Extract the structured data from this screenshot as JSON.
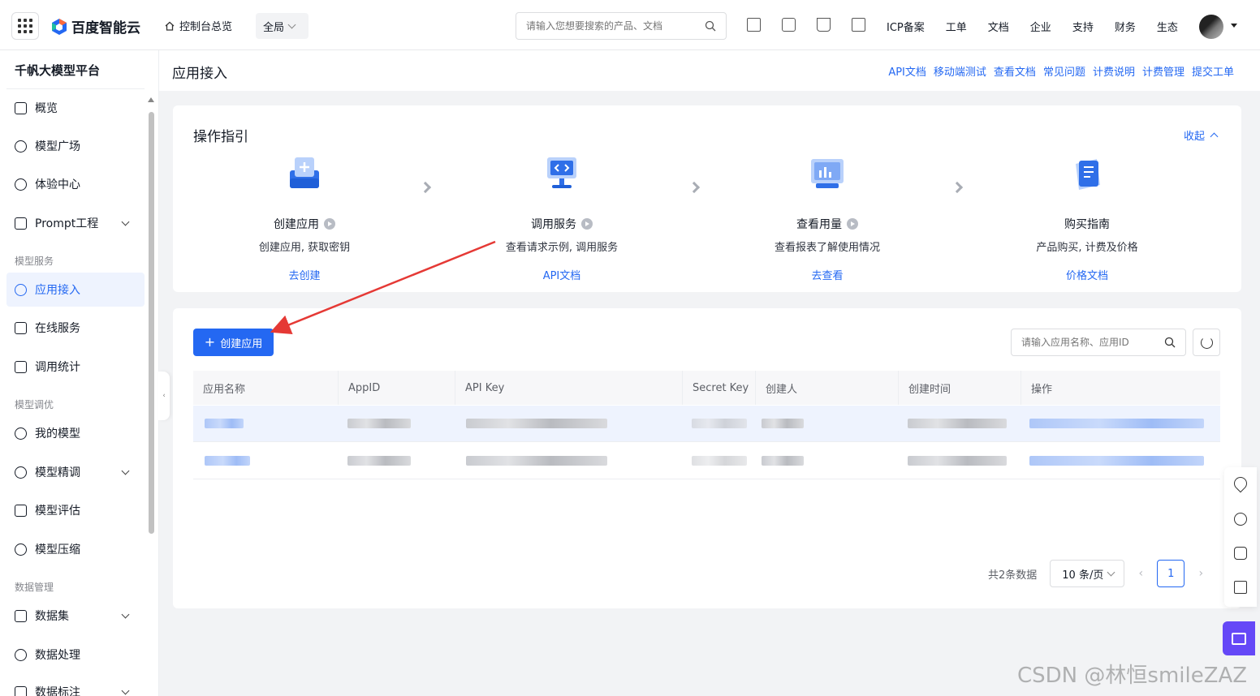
{
  "topbar": {
    "brand": "百度智能云",
    "home_link": "控制台总览",
    "region": "全局",
    "search_placeholder": "请输入您想要搜索的产品、文档",
    "nav": [
      "ICP备案",
      "工单",
      "文档",
      "企业",
      "支持",
      "财务",
      "生态"
    ],
    "icons": [
      "qrcode-icon",
      "message-icon",
      "cart-icon",
      "billing-icon"
    ]
  },
  "sidebar": {
    "title": "千帆大模型平台",
    "items": [
      {
        "label": "概览",
        "icon": "overview-icon"
      },
      {
        "label": "模型广场",
        "icon": "model-plaza-icon"
      },
      {
        "label": "体验中心",
        "icon": "experience-icon"
      },
      {
        "label": "Prompt工程",
        "icon": "prompt-icon",
        "expandable": true
      }
    ],
    "group_model_service": "模型服务",
    "service_items": [
      {
        "label": "应用接入",
        "icon": "app-access-icon",
        "active": true
      },
      {
        "label": "在线服务",
        "icon": "online-service-icon"
      },
      {
        "label": "调用统计",
        "icon": "call-stats-icon"
      }
    ],
    "group_model_tuning": "模型调优",
    "tuning_items": [
      {
        "label": "我的模型",
        "icon": "my-model-icon"
      },
      {
        "label": "模型精调",
        "icon": "fine-tune-icon",
        "expandable": true
      },
      {
        "label": "模型评估",
        "icon": "evaluate-icon"
      },
      {
        "label": "模型压缩",
        "icon": "compress-icon"
      }
    ],
    "group_data": "数据管理",
    "data_items": [
      {
        "label": "数据集",
        "icon": "dataset-icon",
        "expandable": true
      },
      {
        "label": "数据处理",
        "icon": "data-process-icon"
      },
      {
        "label": "数据标注",
        "icon": "data-label-icon",
        "expandable": true
      }
    ]
  },
  "page": {
    "title": "应用接入",
    "links": [
      "API文档",
      "移动端测试",
      "查看文档",
      "常见问题",
      "计费说明",
      "计费管理",
      "提交工单"
    ]
  },
  "guide": {
    "title": "操作指引",
    "collapse": "收起",
    "steps": [
      {
        "name": "创建应用",
        "desc": "创建应用, 获取密钥",
        "link": "去创建",
        "video": true
      },
      {
        "name": "调用服务",
        "desc": "查看请求示例, 调用服务",
        "link": "API文档",
        "video": true
      },
      {
        "name": "查看用量",
        "desc": "查看报表了解使用情况",
        "link": "去查看",
        "video": true
      },
      {
        "name": "购买指南",
        "desc": "产品购买, 计费及价格",
        "link": "价格文档",
        "video": false
      }
    ]
  },
  "table": {
    "create_button": "创建应用",
    "search_placeholder": "请输入应用名称、应用ID",
    "columns": [
      "应用名称",
      "AppID",
      "API Key",
      "Secret Key",
      "创建人",
      "创建时间",
      "操作"
    ],
    "row_count": 2,
    "total_text": "共2条数据",
    "page_size": "10 条/页",
    "current_page": "1"
  },
  "watermark": "CSDN @林恒smileZAZ",
  "colors": {
    "accent": "#2468f2",
    "annotation_arrow": "#e53935",
    "chat_button": "#6548f7"
  }
}
